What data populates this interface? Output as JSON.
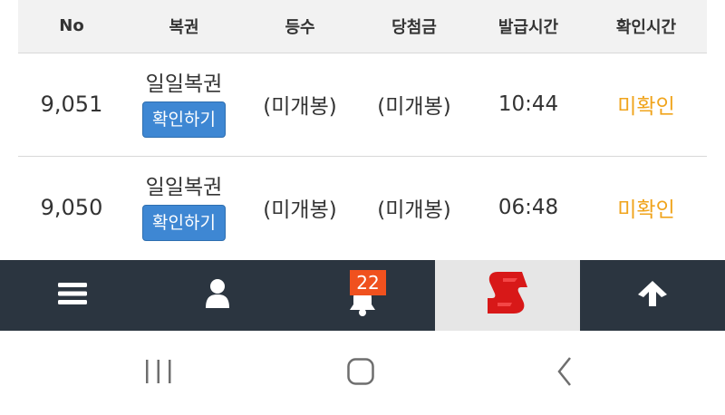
{
  "table": {
    "headers": [
      "No",
      "복권",
      "등수",
      "당첨금",
      "발급시간",
      "확인시간"
    ],
    "rows": [
      {
        "no": "9,051",
        "lotto_name": "일일복권",
        "check_button": "확인하기",
        "rank": "(미개봉)",
        "prize": "(미개봉)",
        "issued_time": "10:44",
        "checked_time": "미확인"
      },
      {
        "no": "9,050",
        "lotto_name": "일일복권",
        "check_button": "확인하기",
        "rank": "(미개봉)",
        "prize": "(미개봉)",
        "issued_time": "06:48",
        "checked_time": "미확인"
      }
    ]
  },
  "toolbar": {
    "items": [
      {
        "icon": "menu-icon"
      },
      {
        "icon": "user-icon"
      },
      {
        "icon": "bell-icon",
        "badge": "22"
      },
      {
        "icon": "brand-logo-icon",
        "active": true
      },
      {
        "icon": "arrow-up-icon"
      }
    ]
  },
  "navbar": {
    "items": [
      {
        "icon": "recent-apps-icon"
      },
      {
        "icon": "home-icon"
      },
      {
        "icon": "back-icon"
      }
    ]
  },
  "colors": {
    "toolbar_bg": "#2b3540",
    "button_blue": "#3e87d3",
    "unconfirmed_orange": "#f0a41c",
    "badge_red": "#f0511e"
  }
}
